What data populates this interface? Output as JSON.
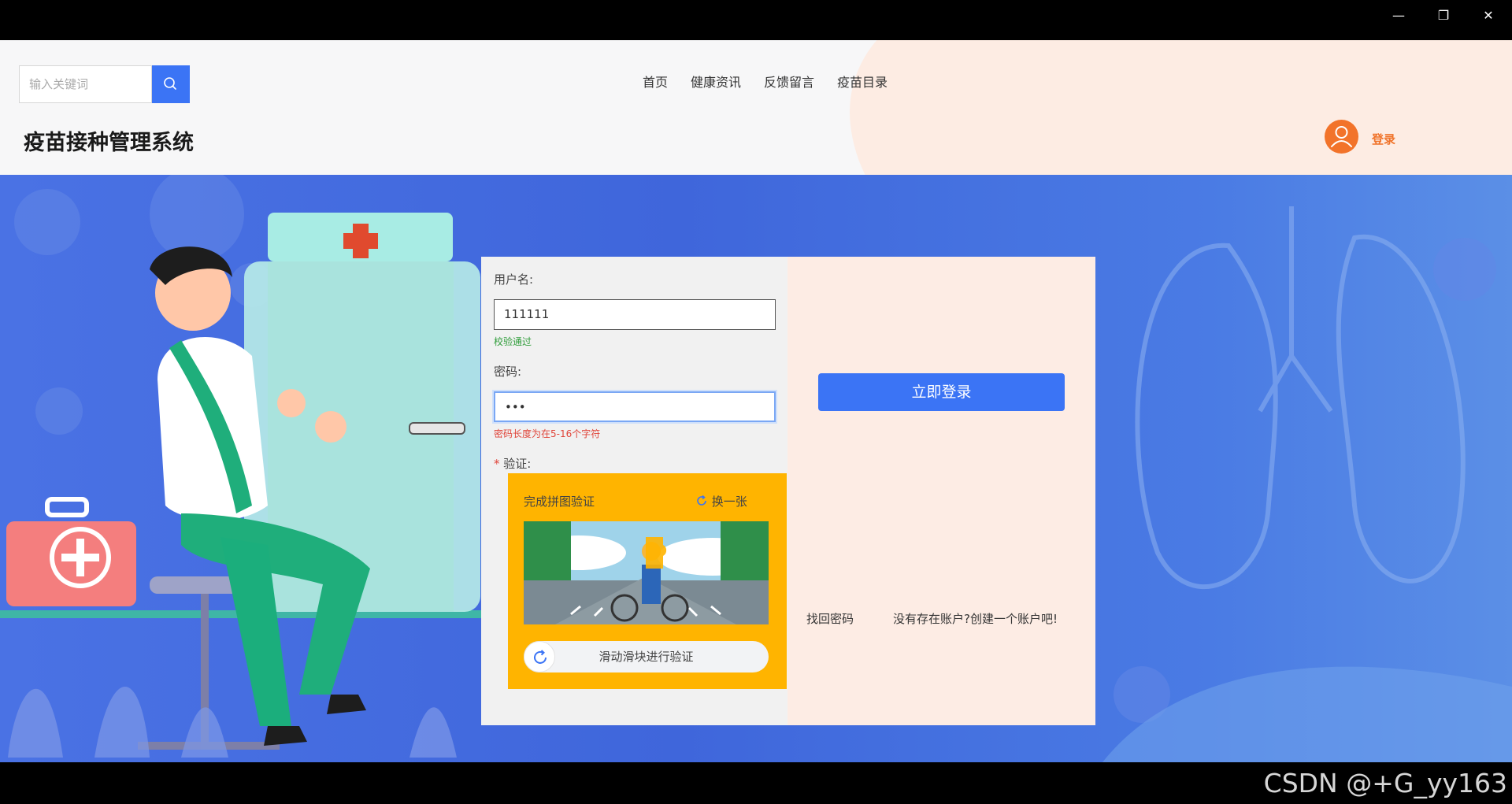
{
  "window": {
    "controls": {
      "minimize": "—",
      "restore": "❐",
      "close": "✕"
    }
  },
  "header": {
    "search": {
      "placeholder": "输入关键词",
      "icon": "search-icon"
    },
    "nav": [
      "首页",
      "健康资讯",
      "反馈留言",
      "疫苗目录"
    ],
    "site_title": "疫苗接种管理系统",
    "user": {
      "avatar_icon": "user-icon",
      "login_label": "登录"
    }
  },
  "login_form": {
    "username": {
      "label": "用户名:",
      "value": "111111",
      "hint": "校验通过"
    },
    "password": {
      "label": "密码:",
      "value": "•••",
      "hint": "密码长度为在5-16个字符"
    },
    "verify": {
      "required_mark": "*",
      "label": "验证:"
    },
    "captcha": {
      "title": "完成拼图验证",
      "refresh_label": "换一张",
      "slider_text": "滑动滑块进行验证"
    },
    "submit_label": "立即登录",
    "forgot_password": "找回密码",
    "register": "没有存在账户?创建一个账户吧!"
  },
  "colors": {
    "accent": "#3b74f5",
    "success": "#2f9d3a",
    "error": "#e0453a",
    "captcha_bg": "#ffb400",
    "brand_orange": "#f0732a"
  },
  "watermark": "CSDN @+G_yy163"
}
